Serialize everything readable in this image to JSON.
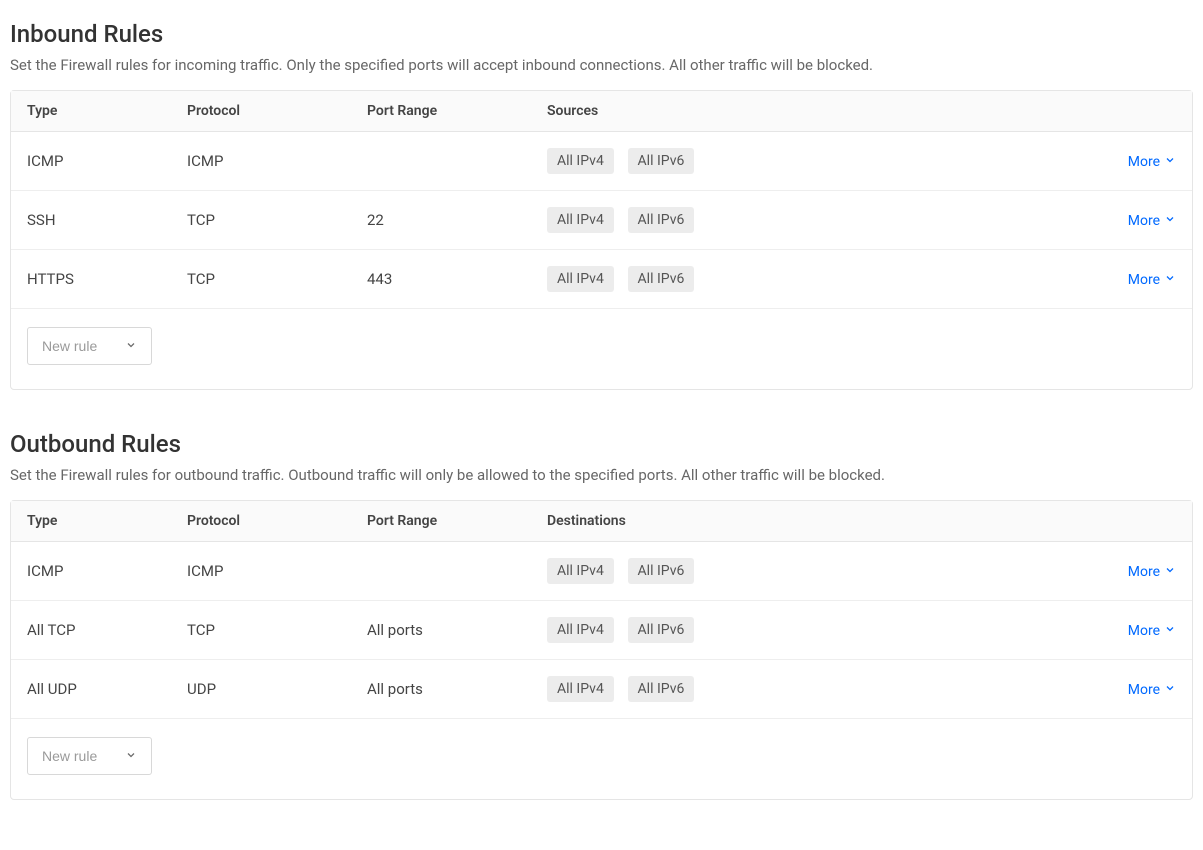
{
  "labels": {
    "more": "More",
    "new_rule": "New rule",
    "tag_ipv4": "All IPv4",
    "tag_ipv6": "All IPv6"
  },
  "columns": {
    "type": "Type",
    "protocol": "Protocol",
    "port_range": "Port Range",
    "sources": "Sources",
    "destinations": "Destinations"
  },
  "sections": [
    {
      "id": "inbound",
      "title": "Inbound Rules",
      "desc": "Set the Firewall rules for incoming traffic. Only the specified ports will accept inbound connections. All other traffic will be blocked.",
      "scope_col": "sources",
      "rules": [
        {
          "type": "ICMP",
          "protocol": "ICMP",
          "port_range": ""
        },
        {
          "type": "SSH",
          "protocol": "TCP",
          "port_range": "22"
        },
        {
          "type": "HTTPS",
          "protocol": "TCP",
          "port_range": "443"
        }
      ]
    },
    {
      "id": "outbound",
      "title": "Outbound Rules",
      "desc": "Set the Firewall rules for outbound traffic. Outbound traffic will only be allowed to the specified ports. All other traffic will be blocked.",
      "scope_col": "destinations",
      "rules": [
        {
          "type": "ICMP",
          "protocol": "ICMP",
          "port_range": ""
        },
        {
          "type": "All TCP",
          "protocol": "TCP",
          "port_range": "All ports"
        },
        {
          "type": "All UDP",
          "protocol": "UDP",
          "port_range": "All ports"
        }
      ]
    }
  ]
}
